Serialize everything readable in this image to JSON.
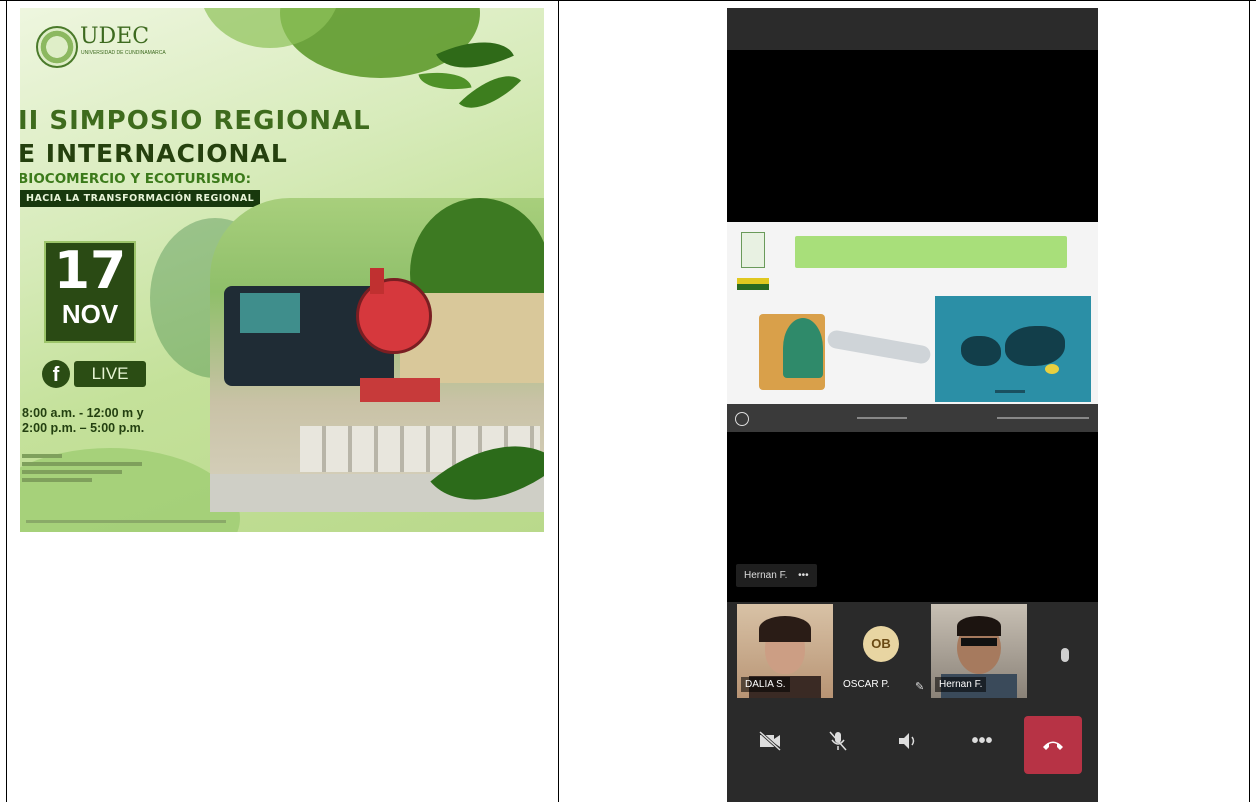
{
  "poster": {
    "logo_name": "UDEC",
    "logo_sub": "UNIVERSIDAD DE CUNDINAMARCA",
    "title_line1": "II SIMPOSIO REGIONAL",
    "title_line2": "E INTERNACIONAL",
    "subtitle": "BIOCOMERCIO Y ECOTURISMO:",
    "banner": "HACIA LA TRANSFORMACIÓN REGIONAL",
    "date_day": "17",
    "date_month": "NOV",
    "facebook_icon": "f",
    "live_label": "LIVE",
    "hours_line1": "8:00 a.m. - 12:00 m y",
    "hours_line2": "2:00 p.m. – 5:00 p.m."
  },
  "meeting": {
    "presenter_label": "Hernan F.",
    "presenter_more": "•••",
    "participants": [
      {
        "name": "DALIA S."
      },
      {
        "initials": "OB",
        "name": "OSCAR P."
      },
      {
        "name": "Hernan F."
      }
    ],
    "controls": [
      {
        "icon": "video-off-icon"
      },
      {
        "icon": "mic-off-icon"
      },
      {
        "icon": "speaker-icon"
      },
      {
        "icon": "more-icon",
        "label": "•••"
      },
      {
        "icon": "end-call-icon"
      }
    ]
  },
  "colors": {
    "poster_dark_green": "#25400e",
    "poster_green": "#3e6b1d",
    "end_call_red": "#b73345",
    "slide_map_blue": "#2b8fa6",
    "slide_note_green": "#a8df7a"
  }
}
